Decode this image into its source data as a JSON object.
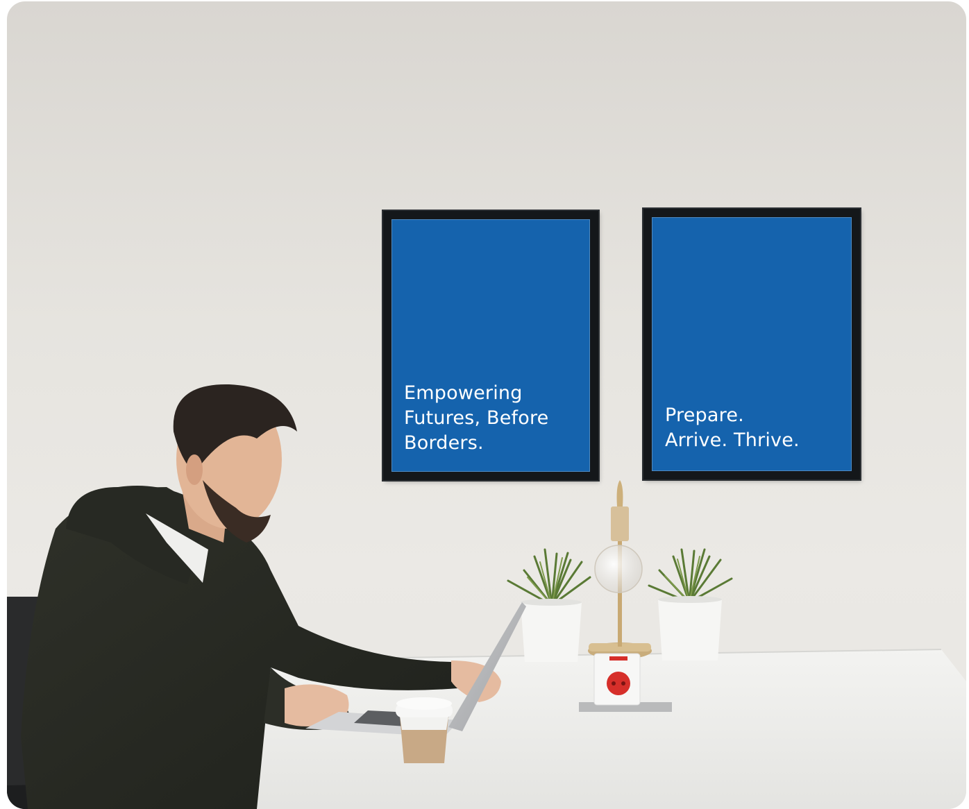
{
  "poster_left": {
    "text": "Empowering\nFutures, Before\nBorders."
  },
  "poster_right": {
    "text": "Prepare.\nArrive. Thrive."
  },
  "colors": {
    "poster_blue": "#1563ad",
    "frame": "#14171a",
    "wall": "#e6e4df",
    "desk": "#f4f4f2"
  }
}
